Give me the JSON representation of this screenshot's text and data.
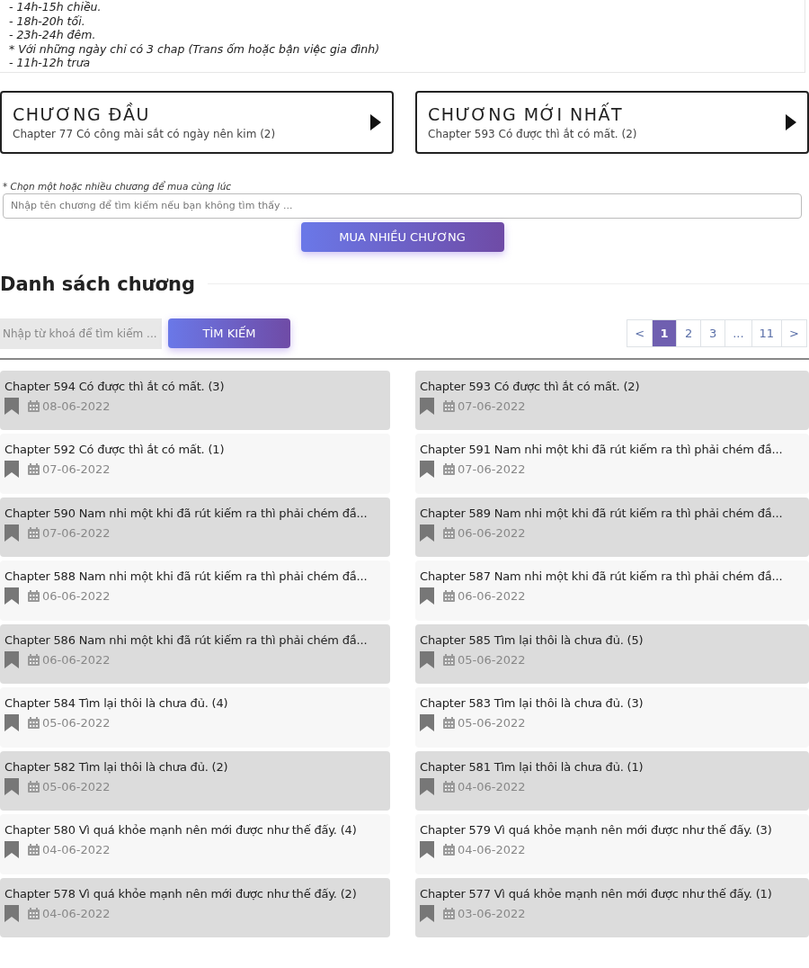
{
  "notice": {
    "lines": [
      "- 14h-15h chiều.",
      "- 18h-20h tối.",
      "- 23h-24h đêm.",
      "* Với những ngày chỉ có 3 chap (Trans ốm hoặc bận việc gia đình)",
      "- 11h-12h trưa"
    ]
  },
  "quick_links": [
    {
      "title": "CHƯƠNG ĐẦU",
      "subtitle": "Chapter 77 Có công mài sắt có ngày nên kim (2)"
    },
    {
      "title": "CHƯƠNG MỚI NHẤT",
      "subtitle": "Chapter 593 Có được thì ắt có mất. (2)"
    }
  ],
  "bulk_buy": {
    "hint": "* Chọn một hoặc nhiều chương để mua cùng lúc",
    "placeholder": "Nhập tên chương để tìm kiếm nếu bạn không tìm thấy ...",
    "button": "MUA NHIỀU CHƯƠNG"
  },
  "chapter_list": {
    "heading": "Danh sách chương",
    "search_placeholder": "Nhập từ khoá để tìm kiếm ...",
    "search_button": "TÌM KIẾM",
    "pagination": [
      {
        "label": "<",
        "selected": false
      },
      {
        "label": "1",
        "selected": true
      },
      {
        "label": "2",
        "selected": false
      },
      {
        "label": "3",
        "selected": false
      },
      {
        "label": "...",
        "selected": false
      },
      {
        "label": "11",
        "selected": false
      },
      {
        "label": ">",
        "selected": false
      }
    ],
    "chapters": [
      {
        "title": "Chapter 594 Có được thì ắt có mất. (3)",
        "date": "08-06-2022"
      },
      {
        "title": "Chapter 593 Có được thì ắt có mất. (2)",
        "date": "07-06-2022"
      },
      {
        "title": "Chapter 592 Có được thì ắt có mất. (1)",
        "date": "07-06-2022"
      },
      {
        "title": "Chapter 591 Nam nhi một khi đã rút kiếm ra thì phải chém đầ...",
        "date": "07-06-2022"
      },
      {
        "title": "Chapter 590 Nam nhi một khi đã rút kiếm ra thì phải chém đầ...",
        "date": "07-06-2022"
      },
      {
        "title": "Chapter 589 Nam nhi một khi đã rút kiếm ra thì phải chém đầ...",
        "date": "06-06-2022"
      },
      {
        "title": "Chapter 588 Nam nhi một khi đã rút kiếm ra thì phải chém đầ...",
        "date": "06-06-2022"
      },
      {
        "title": "Chapter 587 Nam nhi một khi đã rút kiếm ra thì phải chém đầ...",
        "date": "06-06-2022"
      },
      {
        "title": "Chapter 586 Nam nhi một khi đã rút kiếm ra thì phải chém đầ...",
        "date": "06-06-2022"
      },
      {
        "title": "Chapter 585 Tìm lại thôi là chưa đủ. (5)",
        "date": "05-06-2022"
      },
      {
        "title": "Chapter 584 Tìm lại thôi là chưa đủ. (4)",
        "date": "05-06-2022"
      },
      {
        "title": "Chapter 583 Tìm lại thôi là chưa đủ. (3)",
        "date": "05-06-2022"
      },
      {
        "title": "Chapter 582 Tìm lại thôi là chưa đủ. (2)",
        "date": "05-06-2022"
      },
      {
        "title": "Chapter 581 Tìm lại thôi là chưa đủ. (1)",
        "date": "04-06-2022"
      },
      {
        "title": "Chapter 580 Vì quá khỏe mạnh nên mới được như thế đấy. (4)",
        "date": "04-06-2022"
      },
      {
        "title": "Chapter 579 Vì quá khỏe mạnh nên mới được như thế đấy. (3)",
        "date": "04-06-2022"
      },
      {
        "title": "Chapter 578 Vì quá khỏe mạnh nên mới được như thế đấy. (2)",
        "date": "04-06-2022"
      },
      {
        "title": "Chapter 577 Vì quá khỏe mạnh nên mới được như thế đấy. (1)",
        "date": "03-06-2022"
      }
    ]
  }
}
